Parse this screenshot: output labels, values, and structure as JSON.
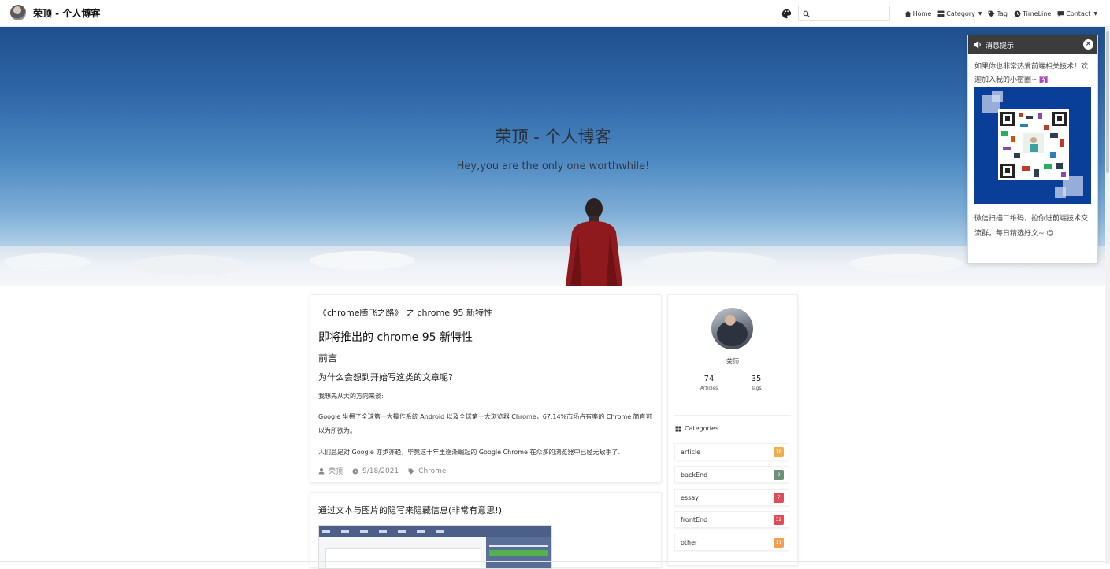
{
  "navbar": {
    "brand_title": "荣顶 - 个人博客",
    "search_placeholder": "",
    "items": [
      {
        "label": "Home",
        "icon": "home-icon"
      },
      {
        "label": "Category",
        "icon": "grid-icon",
        "dropdown": true
      },
      {
        "label": "Tag",
        "icon": "tag-icon"
      },
      {
        "label": "TimeLine",
        "icon": "clock-icon"
      },
      {
        "label": "Contact",
        "icon": "message-icon",
        "dropdown": true
      }
    ]
  },
  "hero": {
    "title": "荣顶 - 个人博客",
    "subtitle": "Hey,you are the only one worthwhile!"
  },
  "popup": {
    "title": "消息提示",
    "close": "×",
    "text1": "如果你也非常热爱前端相关技术！欢迎加入我的小密圈~ 🛐",
    "text2": "微信扫描二维码，拉你进前端技术交流群，每日精选好文~ 😊"
  },
  "posts": [
    {
      "series": "《chrome腾飞之路》 之 chrome 95 新特性",
      "title": "即将推出的 chrome 95 新特性",
      "h2": "前言",
      "h3": "为什么会想到开始写这类的文章呢?",
      "p1": "我想先从大的方向来谈:",
      "p2": "Google 坐拥了全球第一大操作系统 Android 以及全球第一大浏览器 Chrome，67.14%市场占有率的 Chrome 简直可以为所欲为。",
      "p3": "人们总是对 Google 亦步亦趋，毕竟这十年里逐渐崛起的 Google Chrome 在众多的浏览器中已经无敌手了.",
      "author": "荣顶",
      "date": "9/18/2021",
      "tag": "Chrome"
    },
    {
      "title": "通过文本与图片的隐写来隐藏信息(非常有意思!)"
    }
  ],
  "profile": {
    "name": "荣顶",
    "articles_count": "74",
    "articles_label": "Articles",
    "tags_count": "35",
    "tags_label": "Tags"
  },
  "categories": {
    "heading": "Categories",
    "items": [
      {
        "name": "article",
        "count": "18",
        "color": "#f0ad4e"
      },
      {
        "name": "backEnd",
        "count": "2",
        "color": "#6f8f78"
      },
      {
        "name": "essay",
        "count": "7",
        "color": "#e04b5a"
      },
      {
        "name": "frontEnd",
        "count": "32",
        "color": "#e04b5a"
      },
      {
        "name": "other",
        "count": "11",
        "color": "#f0a050"
      }
    ]
  }
}
